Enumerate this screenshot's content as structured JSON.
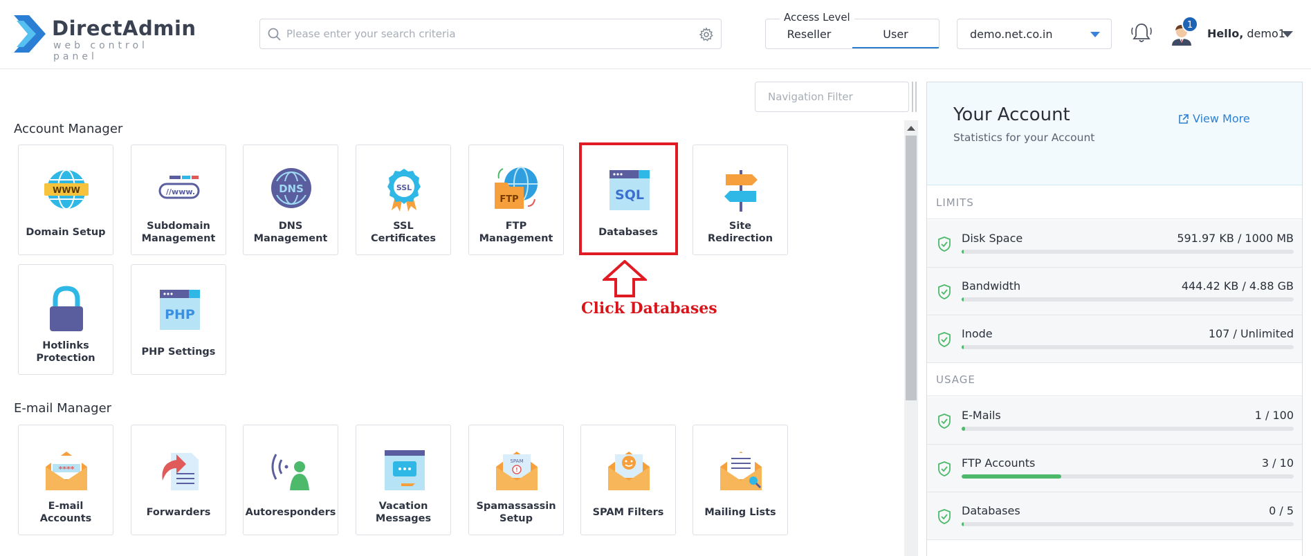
{
  "header": {
    "logo_name": "DirectAdmin",
    "logo_tag": "web control panel",
    "search_placeholder": "Please enter your search criteria",
    "access_level": {
      "title": "Access Level",
      "options": [
        "Reseller",
        "User"
      ],
      "selected": "User"
    },
    "domain": "demo.net.co.in",
    "notifications_count": "1",
    "greeting": "Hello,",
    "username": "demo1"
  },
  "nav_filter_placeholder": "Navigation Filter",
  "sections": [
    {
      "title": "Account Manager",
      "items": [
        {
          "label": "Domain Setup",
          "icon": "www-globe-icon"
        },
        {
          "label": "Subdomain Management",
          "icon": "subdomain-icon"
        },
        {
          "label": "DNS Management",
          "icon": "dns-icon"
        },
        {
          "label": "SSL Certificates",
          "icon": "ssl-badge-icon"
        },
        {
          "label": "FTP Management",
          "icon": "ftp-folder-icon"
        },
        {
          "label": "Databases",
          "icon": "sql-database-icon"
        },
        {
          "label": "Site Redirection",
          "icon": "signpost-icon"
        },
        {
          "label": "Hotlinks Protection",
          "icon": "padlock-icon"
        },
        {
          "label": "PHP Settings",
          "icon": "php-window-icon"
        }
      ]
    },
    {
      "title": "E-mail Manager",
      "items": [
        {
          "label": "E-mail Accounts",
          "icon": "email-password-icon"
        },
        {
          "label": "Forwarders",
          "icon": "forward-icon"
        },
        {
          "label": "Autoresponders",
          "icon": "autoresponder-icon"
        },
        {
          "label": "Vacation Messages",
          "icon": "vacation-message-icon"
        },
        {
          "label": "Spamassassin Setup",
          "icon": "spam-envelope-icon"
        },
        {
          "label": "SPAM Filters",
          "icon": "spam-filter-icon"
        },
        {
          "label": "Mailing Lists",
          "icon": "mailing-list-icon"
        }
      ]
    }
  ],
  "annotation": {
    "text": "Click Databases"
  },
  "account": {
    "title": "Your Account",
    "subtitle": "Statistics for your Account",
    "view_more": "View More",
    "limits_title": "LIMITS",
    "usage_title": "USAGE",
    "limits": [
      {
        "name": "Disk Space",
        "value": "591.97 KB / 1000 MB",
        "fraction": 0.006
      },
      {
        "name": "Bandwidth",
        "value": "444.42 KB / 4.88 GB",
        "fraction": 0.006
      },
      {
        "name": "Inode",
        "value": "107 / Unlimited",
        "fraction": 0.006
      }
    ],
    "usage": [
      {
        "name": "E-Mails",
        "value": "1 / 100",
        "fraction": 0.01
      },
      {
        "name": "FTP Accounts",
        "value": "3 / 10",
        "fraction": 0.3
      },
      {
        "name": "Databases",
        "value": "0 / 5",
        "fraction": 0.0
      }
    ]
  },
  "colors": {
    "accent": "#2f7fd1",
    "annotation_red": "#e01b24",
    "ok_green": "#4cb96b"
  }
}
